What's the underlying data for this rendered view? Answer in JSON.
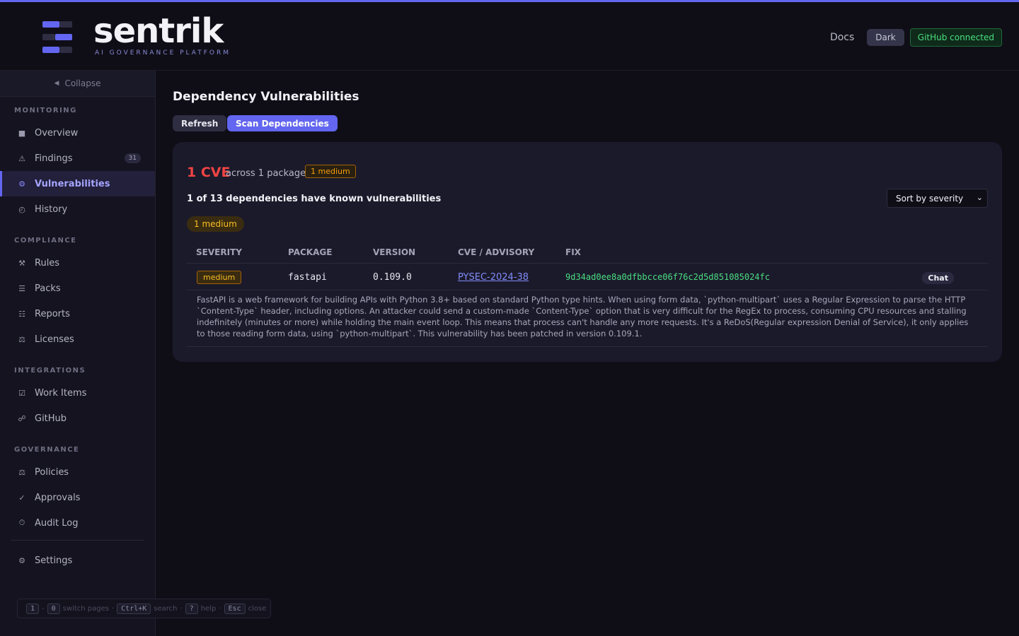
{
  "brand": {
    "name": "sentrik",
    "tagline": "AI GOVERNANCE PLATFORM",
    "accent": "#6366f1"
  },
  "header": {
    "docs": "Docs",
    "theme": "Dark",
    "github_status": "GitHub connected"
  },
  "sidebar": {
    "collapse": "Collapse",
    "sections": {
      "monitoring": "MONITORING",
      "compliance": "COMPLIANCE",
      "integrations": "INTEGRATIONS",
      "governance": "GOVERNANCE"
    },
    "items": {
      "overview": {
        "label": "Overview",
        "icon": "square-icon"
      },
      "findings": {
        "label": "Findings",
        "icon": "warning-icon",
        "count": "31"
      },
      "vulnerabilities": {
        "label": "Vulnerabilities",
        "icon": "gear-icon"
      },
      "history": {
        "label": "History",
        "icon": "clock-icon"
      },
      "rules": {
        "label": "Rules",
        "icon": "tools-icon"
      },
      "packs": {
        "label": "Packs",
        "icon": "list-icon"
      },
      "reports": {
        "label": "Reports",
        "icon": "report-icon"
      },
      "licenses": {
        "label": "Licenses",
        "icon": "scales-icon"
      },
      "work_items": {
        "label": "Work Items",
        "icon": "checkbox-icon"
      },
      "github": {
        "label": "GitHub",
        "icon": "link-icon"
      },
      "policies": {
        "label": "Policies",
        "icon": "scales-icon"
      },
      "approvals": {
        "label": "Approvals",
        "icon": "check-icon"
      },
      "audit_log": {
        "label": "Audit Log",
        "icon": "timer-icon"
      },
      "settings": {
        "label": "Settings",
        "icon": "gear-icon"
      }
    }
  },
  "shortcuts": {
    "key1": "1",
    "key2": "0",
    "label1": "switch pages",
    "key3": "Ctrl+K",
    "label2": "search",
    "key4": "?",
    "label3": "help",
    "key5": "Esc",
    "label4": "close"
  },
  "main": {
    "title": "Dependency Vulnerabilities",
    "refresh": "Refresh",
    "scan": "Scan Dependencies",
    "cve_count": "1 CVE",
    "across": "across 1 package",
    "severity_summary": "1 medium",
    "dependency_summary": "1 of 13 dependencies have known vulnerabilities",
    "sort": "Sort by severity",
    "severity_filter": "1 medium",
    "columns": {
      "severity": "SEVERITY",
      "package": "PACKAGE",
      "version": "VERSION",
      "cve": "CVE / ADVISORY",
      "fix": "FIX"
    },
    "rows": [
      {
        "severity": "medium",
        "package": "fastapi",
        "version": "0.109.0",
        "cve": "PYSEC-2024-38",
        "fix": "9d34ad0ee8a0dfbbcce06f76c2d5d851085024fc",
        "chat": "Chat",
        "description": "FastAPI is a web framework for building APIs with Python 3.8+ based on standard Python type hints. When using form data, `python-multipart` uses a Regular Expression to parse the HTTP `Content-Type` header, including options. An attacker could send a custom-made `Content-Type` option that is very difficult for the RegEx to process, consuming CPU resources and stalling indefinitely (minutes or more) while holding the main event loop. This means that process can't handle any more requests. It's a ReDoS(Regular expression Denial of Service), it only applies to those reading form data, using `python-multipart`. This vulnerability has been patched in version 0.109.1."
      }
    ]
  }
}
